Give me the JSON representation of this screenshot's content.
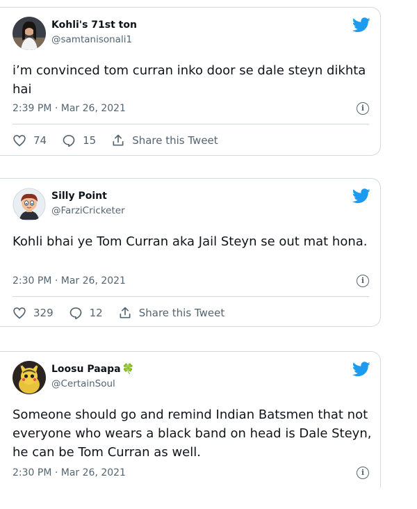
{
  "tweets": [
    {
      "name": "Kohli's 71st ton",
      "handle": "@samtanisonali1",
      "text": "i’m convinced tom curran inko door se dale steyn dikhta hai",
      "time": "2:39 PM · Mar 26, 2021",
      "likes": "74",
      "replies": "15",
      "share": "Share this Tweet"
    },
    {
      "name": "Silly Point",
      "handle": "@FarziCricketer",
      "text": "Kohli bhai ye Tom Curran aka Jail Steyn se out mat hona.",
      "time": "2:30 PM · Mar 26, 2021",
      "likes": "329",
      "replies": "12",
      "share": "Share this Tweet"
    },
    {
      "name": "Loosu Paapa",
      "name_emoji": "🍀",
      "handle": "@CertainSoul",
      "text": "Someone should go and remind Indian Batsmen that not everyone who wears a black band on head is Dale Steyn, he can be Tom Curran as well.",
      "time": "2:30 PM · Mar 26, 2021"
    }
  ],
  "colors": {
    "twitter_blue": "#1d9bf0",
    "muted": "#536471",
    "border": "#cfd9de"
  },
  "icons": [
    "twitter-bird-icon",
    "info-icon",
    "heart-icon",
    "reply-icon",
    "share-icon",
    "clover-icon"
  ]
}
